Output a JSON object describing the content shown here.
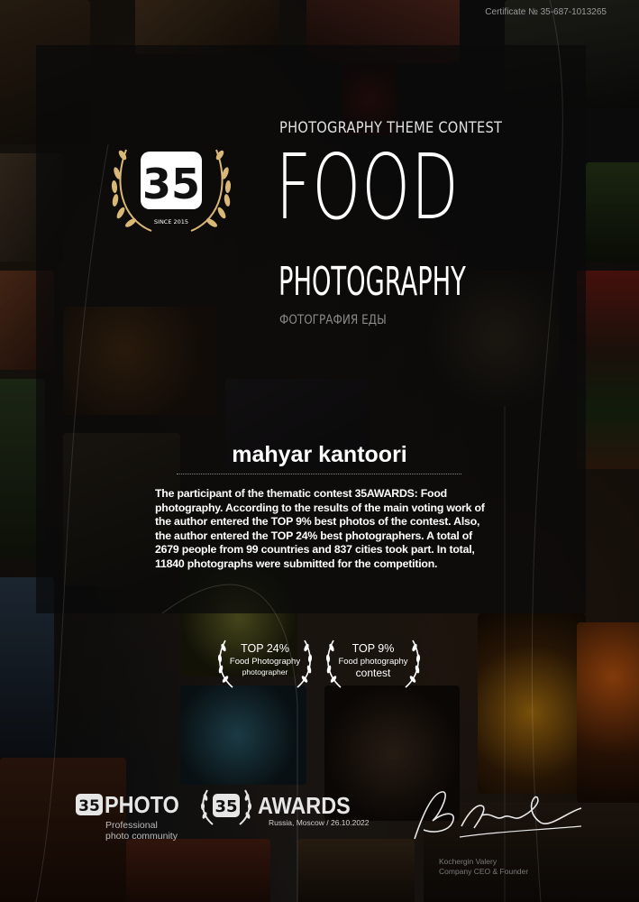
{
  "certificate_number": "Certificate № 35-687-1013265",
  "logo": {
    "mark": "35",
    "since": "SINCE 2015",
    "icon": "35awards-laurel-logo"
  },
  "header": {
    "contest_label": "PHOTOGRAPHY THEME CONTEST",
    "title_line1": "FOOD",
    "title_line2": "PHOTOGRAPHY",
    "title_ru": "ФОТОГРАФИЯ ЕДЫ"
  },
  "participant": {
    "name": "mahyar kantoori",
    "description": "The participant of the thematic contest 35AWARDS: Food photography. According to the results of the main voting work of the author entered the TOP 9% best photos of the contest. Also, the author entered the TOP 24% best photographers. A total of 2679 people from 99 countries and 837 cities took part. In total, 11840 photographs were submitted for the competition."
  },
  "badges": [
    {
      "top": "TOP 24%",
      "mid": "Food Photography",
      "bottom": "photographer"
    },
    {
      "top": "TOP 9%",
      "mid": "Food photography",
      "bottom": "contest"
    }
  ],
  "footer": {
    "photo_logo": "PHOTO",
    "photo_sub1": "Professional",
    "photo_sub2": "photo community",
    "awards_logo": "AWARDS",
    "awards_location_date": "Russia, Moscow / 26.10.2022",
    "signer_name": "Kochergin Valery",
    "signer_role": "Company CEO & Founder"
  }
}
